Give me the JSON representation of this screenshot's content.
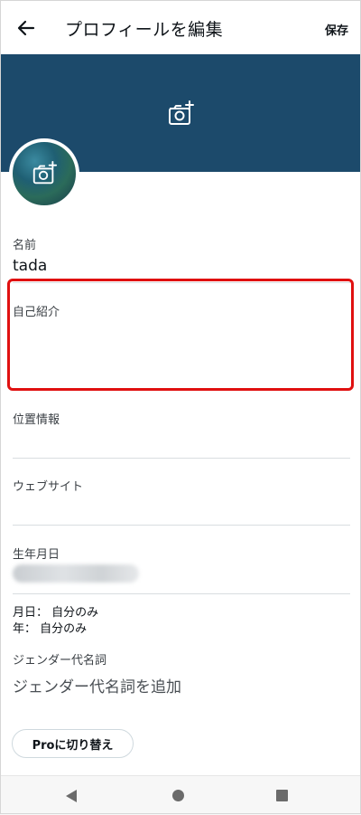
{
  "header": {
    "title": "プロフィールを編集",
    "save_label": "保存"
  },
  "fields": {
    "name": {
      "label": "名前",
      "value": "tada"
    },
    "bio": {
      "label": "自己紹介",
      "value": ""
    },
    "location": {
      "label": "位置情報",
      "value": ""
    },
    "website": {
      "label": "ウェブサイト",
      "value": ""
    },
    "birthday": {
      "label": "生年月日"
    },
    "pronouns": {
      "label": "ジェンダー代名詞",
      "value": "ジェンダー代名詞を追加"
    }
  },
  "birthday_privacy": {
    "month_day": "月日： 自分のみ",
    "year": "年： 自分のみ"
  },
  "pro_button_label": "Proに切り替え",
  "colors": {
    "banner": "#1c4a6b",
    "highlight": "#e01010"
  },
  "icons": [
    "back-arrow-icon",
    "add-photo-icon",
    "nav-back-icon",
    "nav-home-icon",
    "nav-recents-icon"
  ]
}
